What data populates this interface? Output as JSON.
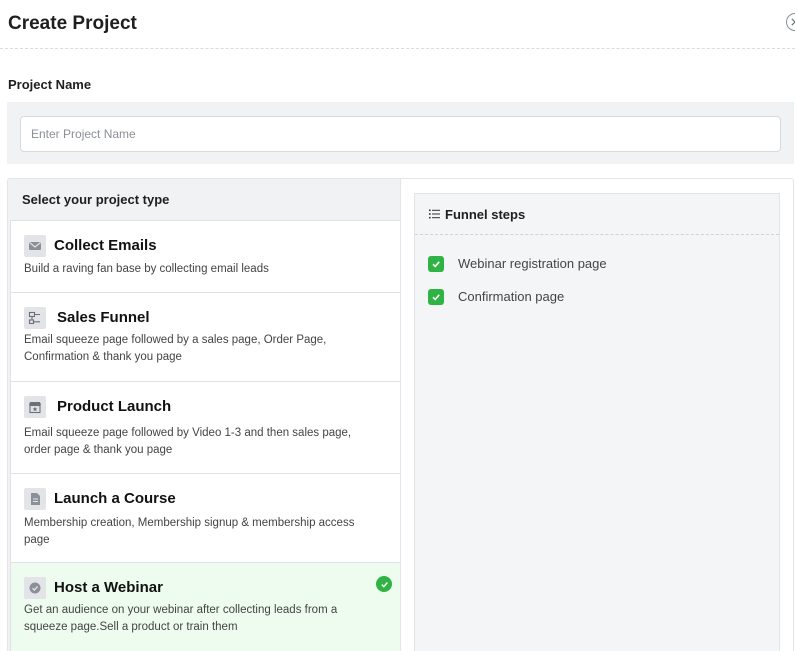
{
  "dialog": {
    "title": "Create Project",
    "project_name_label": "Project Name",
    "project_name_placeholder": "Enter Project Name",
    "project_name_value": ""
  },
  "project_types": {
    "heading": "Select your project type",
    "selected": "Host a Webinar",
    "items": [
      {
        "title": "Collect Emails",
        "description": "Build a raving fan base by collecting email leads",
        "icon": "envelope-icon"
      },
      {
        "title": "Sales Funnel",
        "description": "Email squeeze page followed by a sales page, Order Page, Confirmation & thank you page",
        "icon": "flowchart-icon"
      },
      {
        "title": "Product Launch",
        "description": "Email squeeze page followed by Video 1-3 and then sales page, order page & thank you page",
        "icon": "storefront-star-icon"
      },
      {
        "title": "Launch a Course",
        "description": "Membership creation, Membership signup & membership access page",
        "icon": "document-icon"
      },
      {
        "title": "Host a Webinar",
        "description": "Get an audience on your webinar after collecting leads from a squeeze page.Sell a product or train them",
        "icon": "check-badge-icon"
      }
    ]
  },
  "funnel_steps": {
    "title": "Funnel steps",
    "steps": [
      {
        "label": "Webinar registration page",
        "checked": true
      },
      {
        "label": "Confirmation page",
        "checked": true
      }
    ]
  },
  "colors": {
    "accent_green": "#2fb344",
    "selected_card_bg": "#edfcef",
    "panel_bg": "#f1f2f4"
  }
}
